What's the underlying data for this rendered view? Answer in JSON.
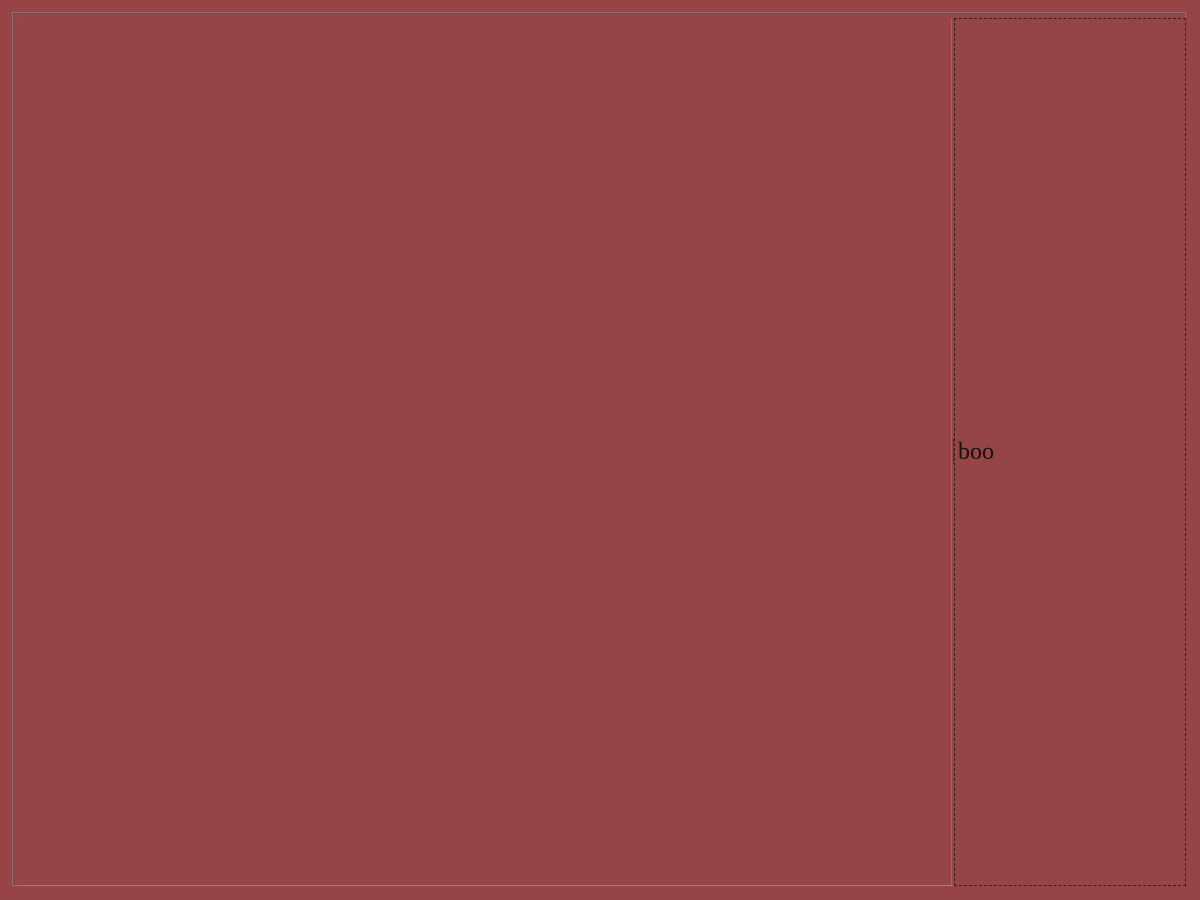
{
  "frames": {
    "main": {
      "label": ""
    },
    "side": {
      "label": "boo"
    }
  },
  "colors": {
    "background": "#974447",
    "frame_border": "#8f7375",
    "side_border": "#2d2222",
    "text": "#111111"
  }
}
